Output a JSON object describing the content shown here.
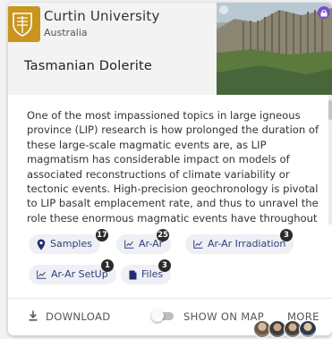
{
  "organization": {
    "name": "Curtin University",
    "country": "Australia",
    "logo_icon": "shield-logo-icon",
    "brand_color": "#c9951f"
  },
  "dataset": {
    "title": "Tasmanian Dolerite",
    "thumbnail": "dolerite-cliffs-photo",
    "lock_icon": "lock-icon",
    "description": "One of the most impassioned topics in large igneous province (LIP) research is how prolonged the duration of these large-scale magmatic events are, as LIP magmatism has considerable impact on models of associated reconstructions of climate variability or tectonic events. High-precision geochronology is pivotal to LIP basalt emplacement rate, and thus to unravel the role these enormous magmatic events have throughout Earths"
  },
  "chips": [
    {
      "label": "Samples",
      "icon": "map-pin-icon",
      "count": "17"
    },
    {
      "label": "Ar-Ar",
      "icon": "scatter-chart-icon",
      "count": "25"
    },
    {
      "label": "Ar-Ar Irradiation",
      "icon": "scatter-chart-icon",
      "count": "3"
    },
    {
      "label": "Ar-Ar SetUp",
      "icon": "scatter-chart-icon",
      "count": "1"
    },
    {
      "label": "Files",
      "icon": "file-icon",
      "count": "3"
    }
  ],
  "footer": {
    "download_label": "DOWNLOAD",
    "show_on_map_label": "SHOW ON MAP",
    "show_on_map_enabled": false,
    "more_label": "MORE"
  },
  "colors": {
    "chip_text": "#33407a",
    "chip_bg": "#eef0f5",
    "badge_bg": "#2b2b2b",
    "lock_bg": "#7a4fc4"
  }
}
